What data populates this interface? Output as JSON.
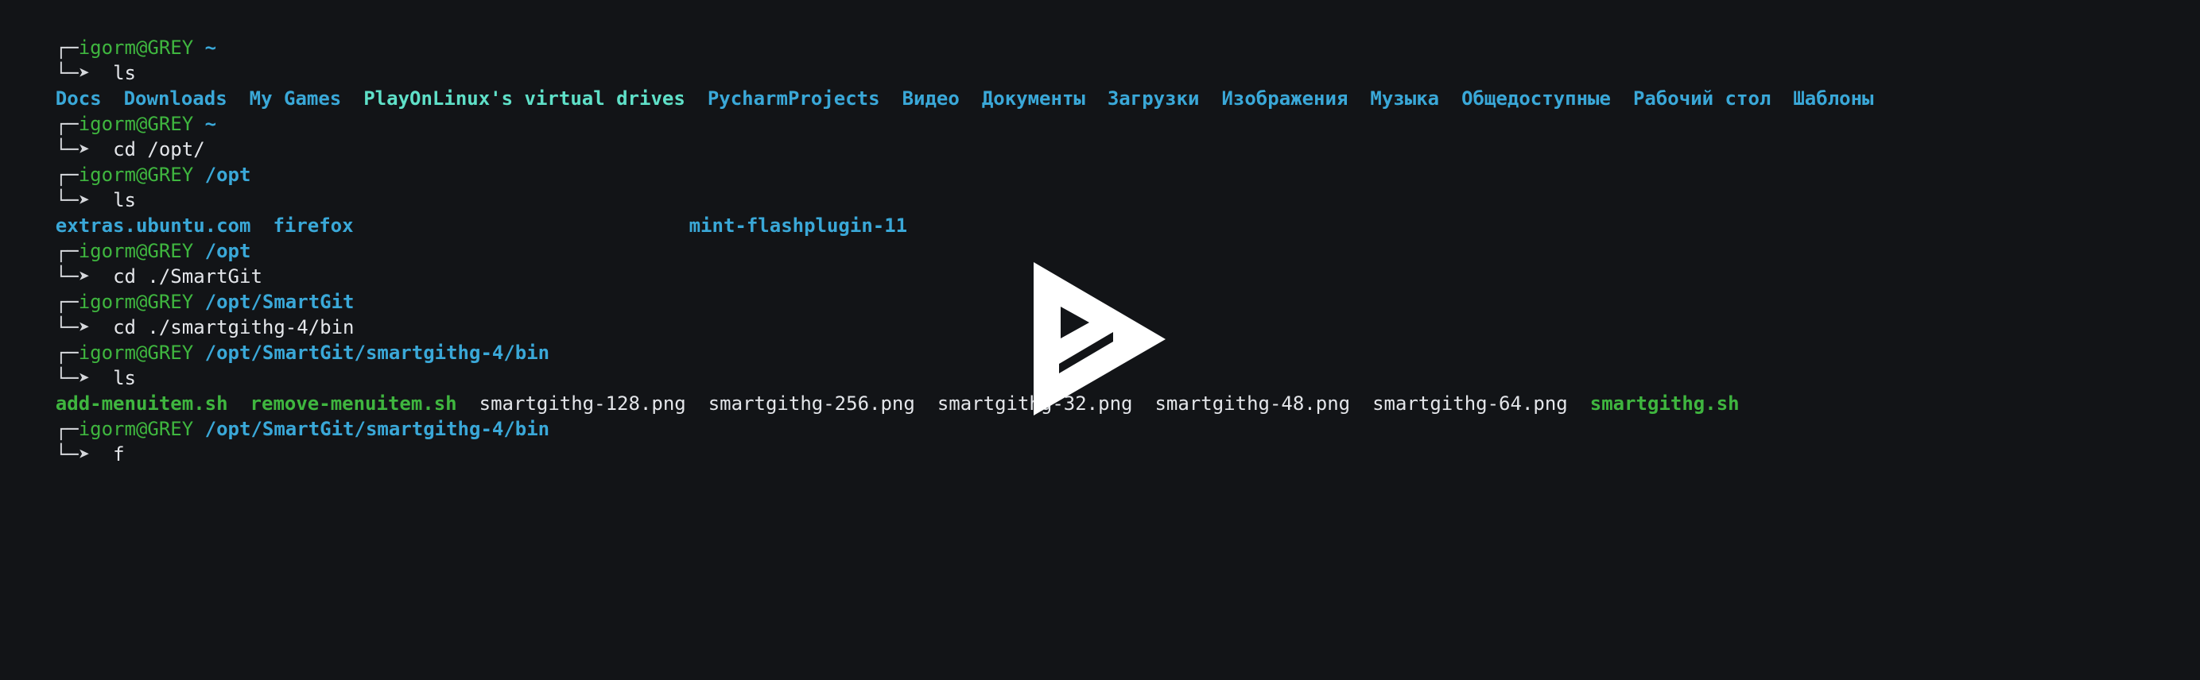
{
  "colors": {
    "background": "#121417",
    "user": "#3fb63f",
    "path": "#3aa8d8",
    "text": "#e4e6ea",
    "highlight_bg": "#45b22c"
  },
  "frame": {
    "top": "┌─",
    "bottom": "└─➤"
  },
  "blocks": [
    {
      "prompt_user": "igorm@GREY",
      "prompt_path": "~",
      "command": "ls"
    },
    {
      "prompt_user": "igorm@GREY",
      "prompt_path": "~",
      "command": "cd /opt/"
    },
    {
      "prompt_user": "igorm@GREY",
      "prompt_path": "/opt",
      "command": "ls"
    },
    {
      "prompt_user": "igorm@GREY",
      "prompt_path": "/opt",
      "command": "cd ./SmartGit"
    },
    {
      "prompt_user": "igorm@GREY",
      "prompt_path": "/opt/SmartGit",
      "command": "cd ./smartgithg-4/bin"
    },
    {
      "prompt_user": "igorm@GREY",
      "prompt_path": "/opt/SmartGit/smartgithg-4/bin",
      "command": "ls"
    },
    {
      "prompt_user": "igorm@GREY",
      "prompt_path": "/opt/SmartGit/smartgithg-4/bin",
      "command": "f"
    }
  ],
  "outputs": {
    "home_ls": [
      "Docs",
      "Downloads",
      "My Games",
      "PlayOnLinux's virtual drives",
      "PycharmProjects",
      "Видео",
      "Документы",
      "Загрузки",
      "Изображения",
      "Музыка",
      "Общедоступные",
      "Рабочий стол",
      "Шаблоны"
    ],
    "opt_ls": [
      "extras.ubuntu.com",
      "firefox",
      "",
      "",
      "",
      "mint-flashplugin-11",
      "",
      "",
      "",
      ""
    ],
    "bin_ls": [
      "add-menuitem.sh",
      "remove-menuitem.sh",
      "smartgithg-128.png",
      "smartgithg-256.png",
      "smartgithg-32.png",
      "smartgithg-48.png",
      "smartgithg-64.png",
      "smartgithg.sh"
    ]
  },
  "overlay": {
    "icon": "play-icon"
  }
}
